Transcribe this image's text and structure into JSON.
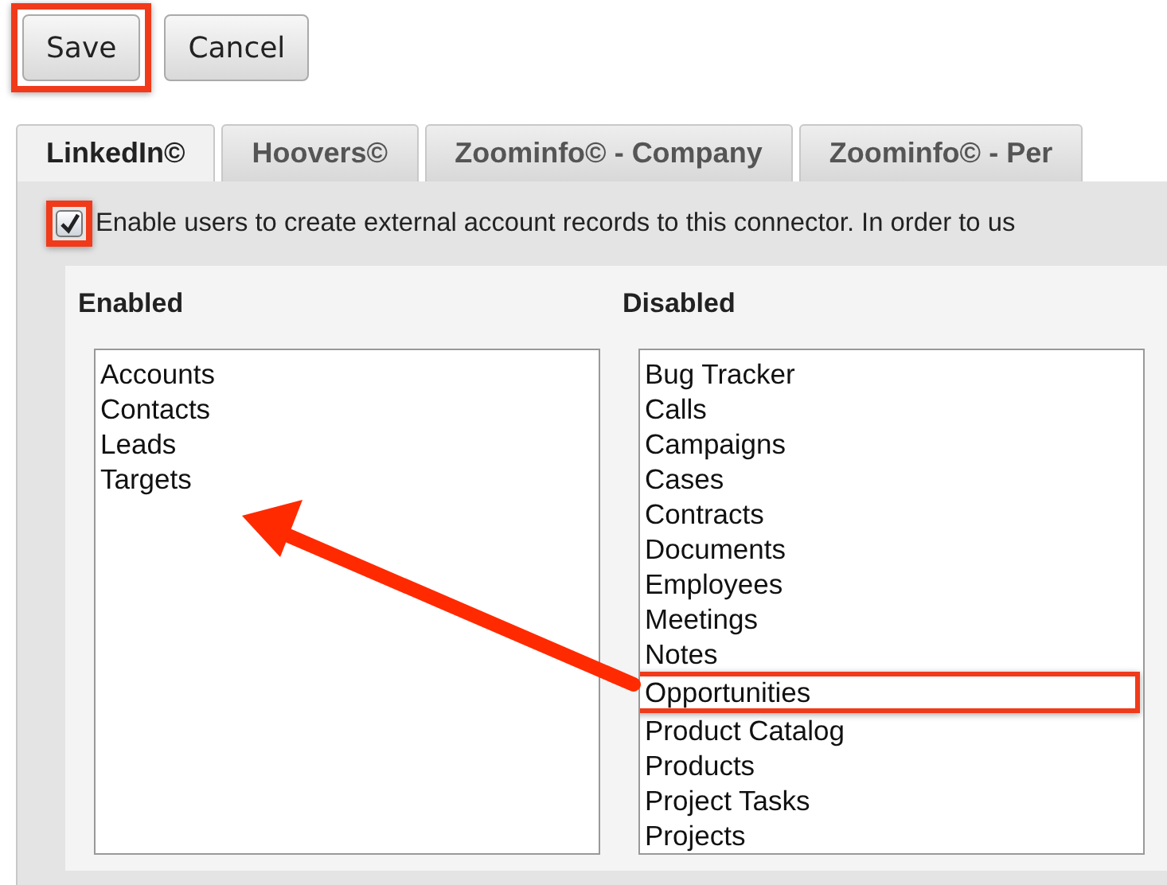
{
  "toolbar": {
    "buttons": [
      {
        "label": "Save",
        "highlighted": true
      },
      {
        "label": "Cancel",
        "highlighted": false
      }
    ]
  },
  "tabs": [
    {
      "label": "LinkedIn©",
      "selected": true
    },
    {
      "label": "Hoovers©",
      "selected": false
    },
    {
      "label": "Zoominfo© - Company",
      "selected": false
    },
    {
      "label": "Zoominfo© - Per",
      "selected": false
    }
  ],
  "enable_option": {
    "label": "Enable users to create external account records to this connector. In order to us",
    "checked": true,
    "highlighted": true
  },
  "enabled": {
    "heading": "Enabled",
    "items": [
      {
        "label": "Accounts",
        "highlighted": false
      },
      {
        "label": "Contacts",
        "highlighted": false
      },
      {
        "label": "Leads",
        "highlighted": false
      },
      {
        "label": "Targets",
        "highlighted": false
      }
    ]
  },
  "disabled": {
    "heading": "Disabled",
    "items": [
      {
        "label": "Bug Tracker",
        "highlighted": false
      },
      {
        "label": "Calls",
        "highlighted": false
      },
      {
        "label": "Campaigns",
        "highlighted": false
      },
      {
        "label": "Cases",
        "highlighted": false
      },
      {
        "label": "Contracts",
        "highlighted": false
      },
      {
        "label": "Documents",
        "highlighted": false
      },
      {
        "label": "Employees",
        "highlighted": false
      },
      {
        "label": "Meetings",
        "highlighted": false
      },
      {
        "label": "Notes",
        "highlighted": false
      },
      {
        "label": "Opportunities",
        "highlighted": true
      },
      {
        "label": "Product Catalog",
        "highlighted": false
      },
      {
        "label": "Products",
        "highlighted": false
      },
      {
        "label": "Project Tasks",
        "highlighted": false
      },
      {
        "label": "Projects",
        "highlighted": false
      }
    ]
  }
}
